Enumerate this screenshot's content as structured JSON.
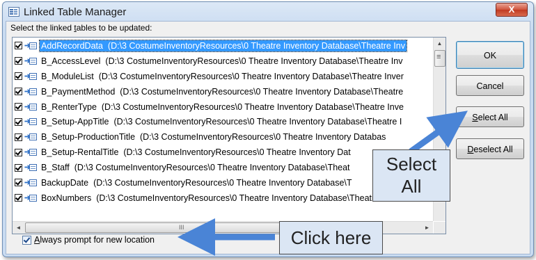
{
  "window": {
    "title": "Linked Table Manager",
    "close_label": "X"
  },
  "instruction": {
    "text_before": "Select the linked ",
    "mnemonic": "t",
    "text_after": "ables to be updated:"
  },
  "rows": [
    {
      "name": "AddRecordData",
      "path": "(D:\\3 CostumeInventoryResources\\0 Theatre Inventory Database\\Theatre Inv"
    },
    {
      "name": "B_AccessLevel",
      "path": "(D:\\3 CostumeInventoryResources\\0 Theatre Inventory Database\\Theatre Inv"
    },
    {
      "name": "B_ModuleList",
      "path": "(D:\\3 CostumeInventoryResources\\0 Theatre Inventory Database\\Theatre Inver"
    },
    {
      "name": "B_PaymentMethod",
      "path": "(D:\\3 CostumeInventoryResources\\0 Theatre Inventory Database\\Theatre"
    },
    {
      "name": "B_RenterType",
      "path": "(D:\\3 CostumeInventoryResources\\0 Theatre Inventory Database\\Theatre Inve"
    },
    {
      "name": "B_Setup-AppTitle",
      "path": "(D:\\3 CostumeInventoryResources\\0 Theatre Inventory Database\\Theatre I"
    },
    {
      "name": "B_Setup-ProductionTitle",
      "path": "(D:\\3 CostumeInventoryResources\\0 Theatre Inventory Databas"
    },
    {
      "name": "B_Setup-RentalTitle",
      "path": "(D:\\3 CostumeInventoryResources\\0 Theatre Inventory Dat"
    },
    {
      "name": "B_Staff",
      "path": "(D:\\3 CostumeInventoryResources\\0 Theatre Inventory Database\\Theat"
    },
    {
      "name": "BackupDate",
      "path": "(D:\\3 CostumeInventoryResources\\0 Theatre Inventory Database\\T"
    },
    {
      "name": "BoxNumbers",
      "path": "(D:\\3 CostumeInventoryResources\\0 Theatre Inventory Database\\Theatre Inven"
    }
  ],
  "scroll": {
    "up": "▲",
    "left": "◄",
    "right": "►",
    "grip": "III"
  },
  "buttons": {
    "ok": "OK",
    "cancel": "Cancel",
    "select_all": {
      "mnemonic": "S",
      "rest": "elect All"
    },
    "deselect_all": {
      "mnemonic": "D",
      "rest": "eselect All"
    }
  },
  "prompt_checkbox": {
    "mnemonic": "A",
    "rest": "lways prompt for new location"
  },
  "annotations": {
    "select_all_line1": "Select",
    "select_all_line2": "All",
    "click_here": "Click here"
  },
  "colors": {
    "selection": "#3399ff",
    "arrow": "#4a84d6",
    "callout_bg": "#dbe6f4"
  }
}
